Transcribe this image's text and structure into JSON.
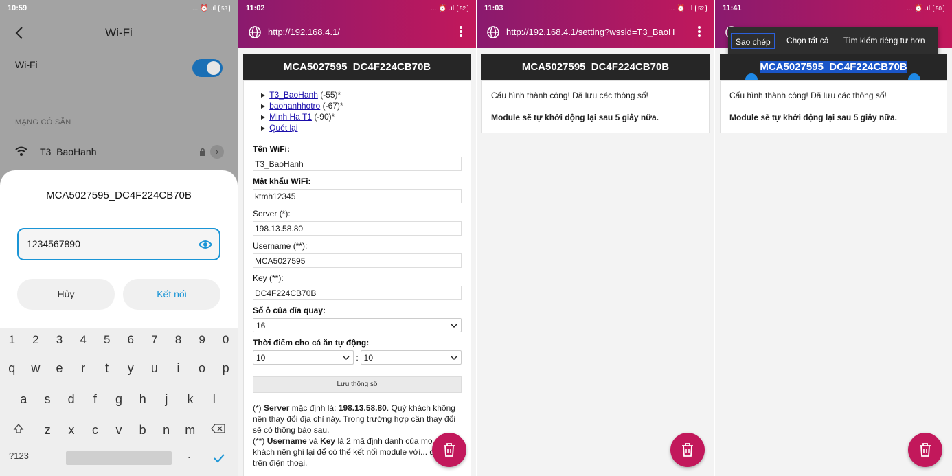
{
  "phone_settings": {
    "status": {
      "time": "10:59",
      "icons": "... ⏰ .ıl",
      "battery": "53"
    },
    "title": "Wi-Fi",
    "wifi_label": "Wi-Fi",
    "wifi_enabled": true,
    "section_label": "MẠNG CÓ SẴN",
    "network_name": "T3_BaoHanh",
    "dialog": {
      "title": "MCA5027595_DC4F224CB70B",
      "password": "1234567890",
      "cancel": "Hủy",
      "connect": "Kết nối"
    },
    "keyboard": {
      "numbers": [
        "1",
        "2",
        "3",
        "4",
        "5",
        "6",
        "7",
        "8",
        "9",
        "0"
      ],
      "row1": [
        "q",
        "w",
        "e",
        "r",
        "t",
        "y",
        "u",
        "i",
        "o",
        "p"
      ],
      "row2": [
        "a",
        "s",
        "d",
        "f",
        "g",
        "h",
        "j",
        "k",
        "l"
      ],
      "row3": [
        "z",
        "x",
        "c",
        "v",
        "b",
        "n",
        "m"
      ],
      "sym": "?123",
      "period": "."
    }
  },
  "browser_form": {
    "status": {
      "time": "11:02",
      "icons": "... ⏰ .ıl",
      "battery": "52"
    },
    "url": "http://192.168.4.1/",
    "page_title": "MCA5027595_DC4F224CB70B",
    "networks": [
      {
        "name": "T3_BaoHanh",
        "signal": "(-55)*"
      },
      {
        "name": "baohanhhotro",
        "signal": "(-67)*"
      },
      {
        "name": "Minh Ha T1",
        "signal": "(-90)*"
      },
      {
        "name": "Quét lại",
        "signal": ""
      }
    ],
    "fields": {
      "wifi_name_label": "Tên WiFi:",
      "wifi_name": "T3_BaoHanh",
      "wifi_pass_label": "Mật khẩu WiFi:",
      "wifi_pass": "ktmh12345",
      "server_label": "Server (*):",
      "server": "198.13.58.80",
      "username_label": "Username (**):",
      "username": "MCA5027595",
      "key_label": "Key (**):",
      "key": "DC4F224CB70B",
      "slots_label": "Số ô của đĩa quay:",
      "slots": "16",
      "feed_time_label": "Thời điểm cho cá ăn tự động:",
      "feed_hour": "10",
      "feed_min": "10",
      "time_separator": ":",
      "save": "Lưu thông số"
    },
    "note1_prefix": "(*)",
    "note1_bold": "Server",
    "note1_mid": "mặc định là:",
    "note1_value": "198.13.58.80",
    "note1_rest": ". Quý khách không nên thay đổi địa chỉ này. Trong trường hợp cần thay đổi sẽ có thông báo sau.",
    "note2_prefix": "(**)",
    "note2_bold1": "Username",
    "note2_and": "và",
    "note2_bold2": "Key",
    "note2_rest": "là 2 mã định danh của mo... Quý khách nên ghi lại để có thể kết nối module với... dụng trên điện thoại."
  },
  "browser_saved": {
    "status": {
      "time": "11:03",
      "icons": "... ⏰ .ıl",
      "battery": "52"
    },
    "url": "http://192.168.4.1/setting?wssid=T3_BaoH",
    "page_title": "MCA5027595_DC4F224CB70B",
    "line1": "Cấu hình thành công! Đã lưu các thông số!",
    "line2": "Module sẽ tự khởi động lại sau 5 giây nữa."
  },
  "browser_copy": {
    "status": {
      "time": "11:41",
      "icons": "... ⏰ .ıl",
      "battery": "50"
    },
    "menu": {
      "copy": "Sao chép",
      "select_all": "Chọn tất cả",
      "search": "Tìm kiếm riêng tư hơn"
    },
    "page_title": "MCA5027595_DC4F224CB70B",
    "line1": "Cấu hình thành công! Đã lưu các thông số!",
    "line2": "Module sẽ tự khởi động lại sau 5 giây nữa."
  },
  "colors": {
    "accent": "#c2185b",
    "chrome_left": "#8a1a6e",
    "toggle_blue": "#1a6fb5",
    "dialog_blue": "#1a95d6"
  }
}
